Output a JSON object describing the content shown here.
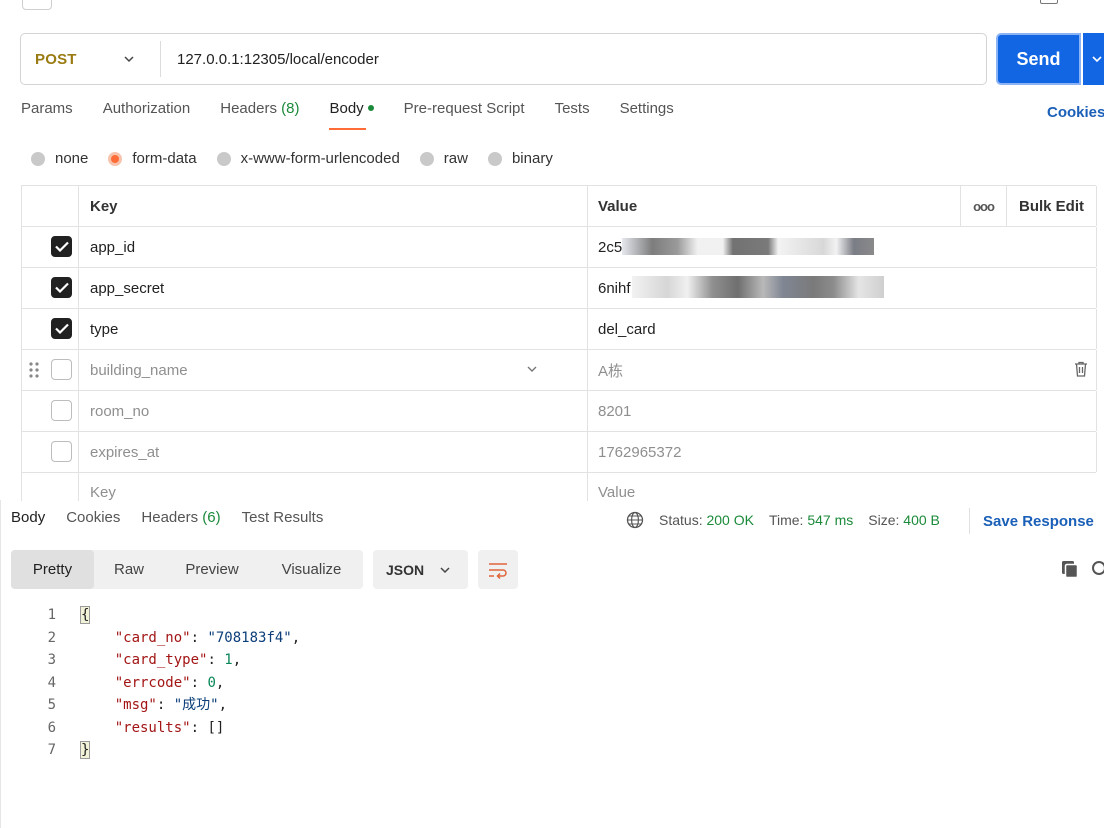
{
  "request": {
    "method": "POST",
    "url": "127.0.0.1:12305/local/encoder",
    "send_label": "Send"
  },
  "tabs": {
    "params": "Params",
    "authorization": "Authorization",
    "headers_label": "Headers",
    "headers_count": "(8)",
    "body": "Body",
    "prerequest": "Pre-request Script",
    "tests": "Tests",
    "settings": "Settings",
    "cookies": "Cookies"
  },
  "body_types": [
    "none",
    "form-data",
    "x-www-form-urlencoded",
    "raw",
    "binary"
  ],
  "table": {
    "key_header": "Key",
    "value_header": "Value",
    "more": "ooo",
    "bulk_edit": "Bulk Edit",
    "rows": [
      {
        "key": "app_id",
        "value": "2c5",
        "checked": true
      },
      {
        "key": "app_secret",
        "value": "6nihf",
        "checked": true
      },
      {
        "key": "type",
        "value": "del_card",
        "checked": true
      },
      {
        "key": "building_name",
        "value": "A栋",
        "checked": false
      },
      {
        "key": "room_no",
        "value": "8201",
        "checked": false
      },
      {
        "key": "expires_at",
        "value": "1762965372",
        "checked": false
      }
    ],
    "placeholder_key": "Key",
    "placeholder_value": "Value"
  },
  "response": {
    "tabs": {
      "body": "Body",
      "cookies": "Cookies",
      "headers_label": "Headers",
      "headers_count": "(6)",
      "test_results": "Test Results"
    },
    "status_label": "Status:",
    "status_value": "200 OK",
    "time_label": "Time:",
    "time_value": "547 ms",
    "size_label": "Size:",
    "size_value": "400 B",
    "save_label": "Save Response",
    "views": [
      "Pretty",
      "Raw",
      "Preview",
      "Visualize"
    ],
    "format": "JSON"
  },
  "code_lines": [
    {
      "n": "1"
    },
    {
      "n": "2",
      "key": "\"card_no\"",
      "val": "\"708183f4\"",
      "type": "s",
      "comma": ","
    },
    {
      "n": "3",
      "key": "\"card_type\"",
      "val": "1",
      "type": "n",
      "comma": ","
    },
    {
      "n": "4",
      "key": "\"errcode\"",
      "val": "0",
      "type": "n",
      "comma": ","
    },
    {
      "n": "5",
      "key": "\"msg\"",
      "val": "\"成功\"",
      "type": "s",
      "comma": ","
    },
    {
      "n": "6",
      "key": "\"results\"",
      "val": "[]",
      "type": "p",
      "comma": ""
    },
    {
      "n": "7"
    }
  ],
  "colors": {
    "accent": "#ff6c37",
    "send": "#1266e3",
    "method": "#9a7b12",
    "status_ok": "#1b8a3a",
    "link": "#1a5fb8"
  },
  "icons": [
    "back-arrow-icon",
    "chevron-down-icon",
    "check-icon",
    "drag-handle-icon",
    "trash-icon",
    "globe-icon",
    "wrap-lines-icon",
    "copy-icon",
    "search-icon"
  ]
}
